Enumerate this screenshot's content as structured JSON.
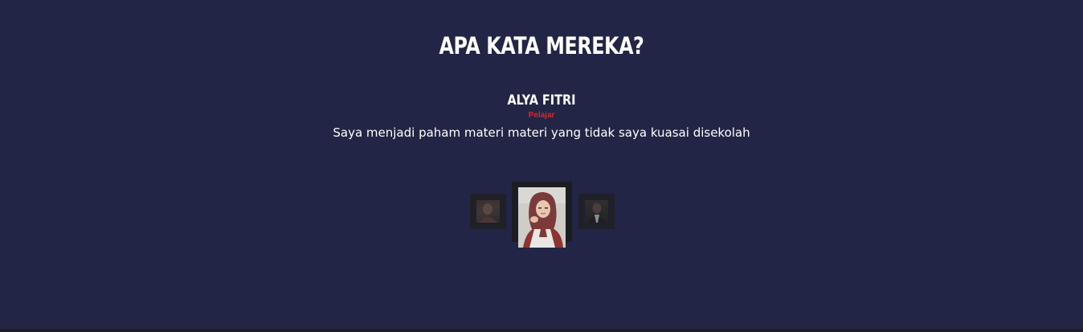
{
  "testimonials": {
    "heading": "APA KATA MEREKA?",
    "active": {
      "name": "ALYA FITRI",
      "role": "Pelajar",
      "quote": "Saya menjadi paham materi materi yang tidak saya kuasai disekolah"
    },
    "thumbnails": [
      {
        "state": "inactive",
        "icon": "person-photo-icon"
      },
      {
        "state": "active",
        "icon": "person-photo-icon"
      },
      {
        "state": "inactive",
        "icon": "person-photo-icon"
      }
    ]
  },
  "colors": {
    "background": "#232546",
    "accent": "#d42a2a",
    "text": "#ffffff"
  }
}
